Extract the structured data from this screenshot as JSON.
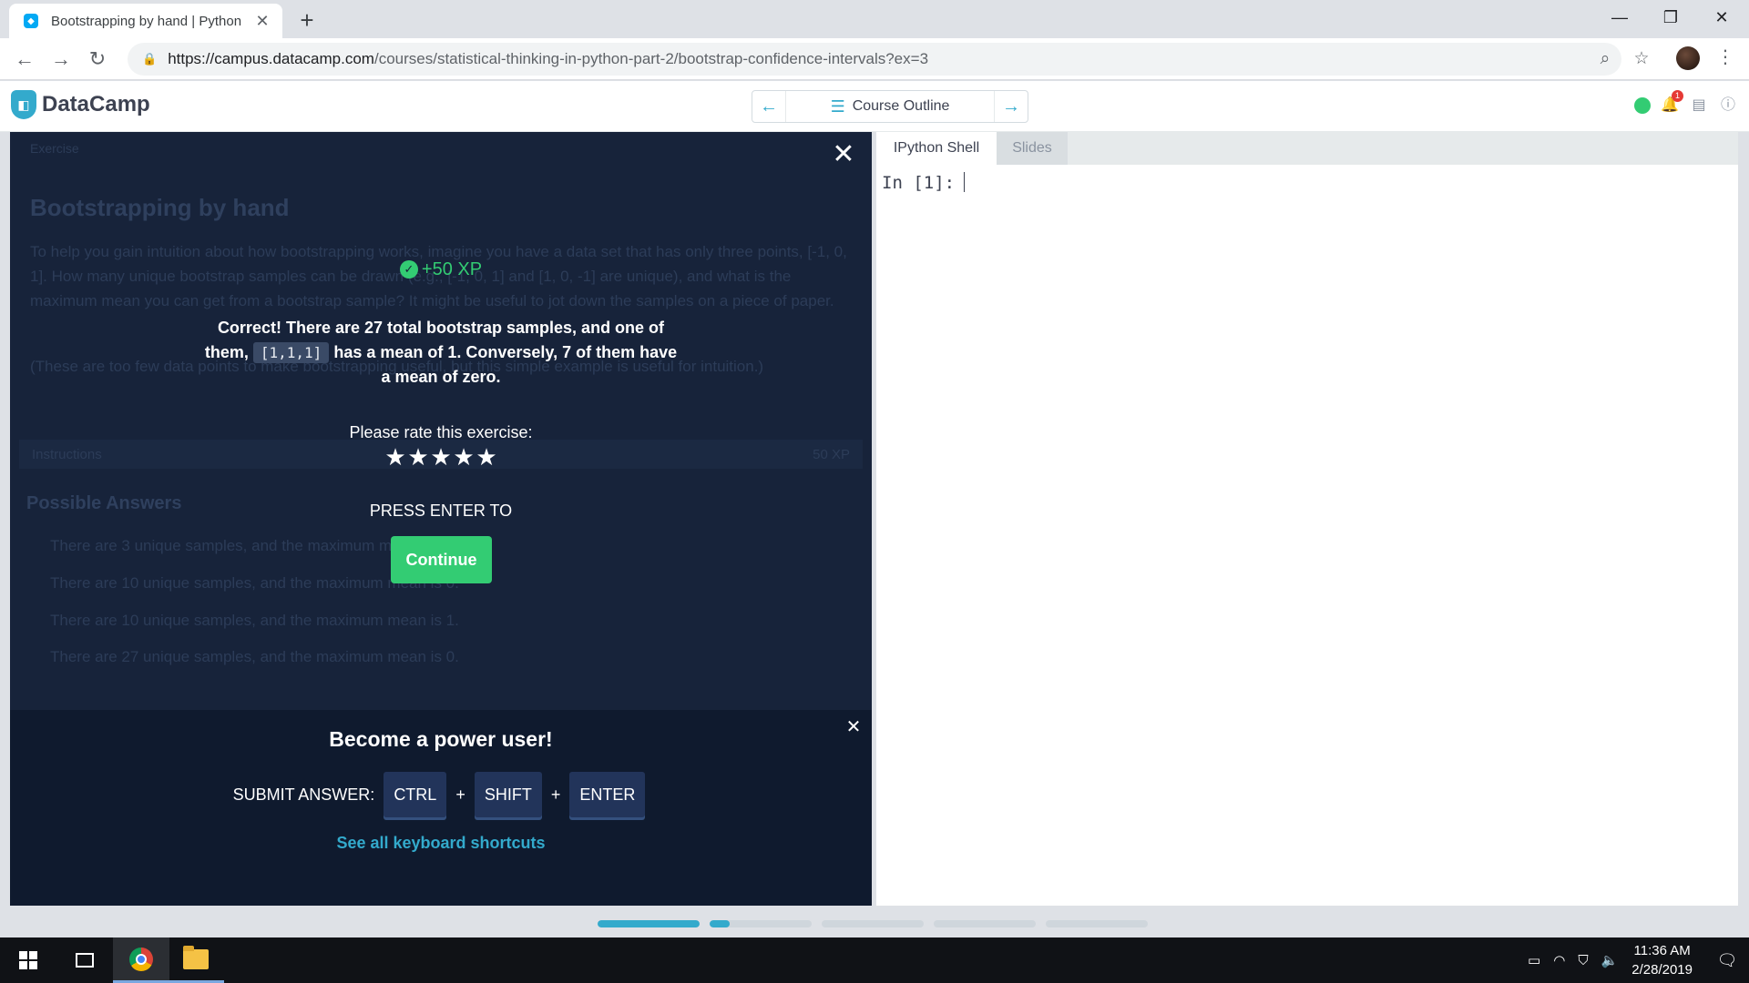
{
  "browser": {
    "tab_title": "Bootstrapping by hand | Python",
    "url_host": "https://campus.datacamp.com",
    "url_path": "/courses/statistical-thinking-in-python-part-2/bootstrap-confidence-intervals?ex=3"
  },
  "header": {
    "brand": "DataCamp",
    "course_outline": "Course Outline",
    "notification_count": "1"
  },
  "exercise": {
    "label": "Exercise",
    "title": "Bootstrapping by hand",
    "body": "To help you gain intuition about how bootstrapping works, imagine you have a data set that has only three points, [-1, 0, 1]. How many unique bootstrap samples can be drawn (e.g., [-1, 0, 1] and [1, 0, -1] are unique), and what is the maximum mean you can get from a bootstrap sample? It might be useful to jot down the samples on a piece of paper.",
    "note": "(These are too few data points to make bootstrapping useful, but this simple example is useful for intuition.)",
    "instructions_label": "Instructions",
    "instructions_xp": "50 XP",
    "possible_answers_title": "Possible Answers",
    "answers": [
      "There are 3 unique samples, and the maximum mean is 1.",
      "There are 10 unique samples, and the maximum mean is 0.",
      "There are 10 unique samples, and the maximum mean is 1.",
      "There are 27 unique samples, and the maximum mean is 0."
    ]
  },
  "modal": {
    "xp": "+50 XP",
    "feedback_before": "Correct! There are 27 total bootstrap samples, and one of them,",
    "feedback_code": "[1,1,1]",
    "feedback_after": "has a mean of 1. Conversely, 7 of them have a mean of zero.",
    "rate_label": "Please rate this exercise:",
    "star_count": 5,
    "press_enter": "PRESS ENTER TO",
    "continue_label": "Continue"
  },
  "power_user": {
    "title": "Become a power user!",
    "submit_label": "SUBMIT ANSWER:",
    "keys": [
      "CTRL",
      "SHIFT",
      "ENTER"
    ],
    "see_all": "See all keyboard shortcuts"
  },
  "console": {
    "tabs": [
      "IPython Shell",
      "Slides"
    ],
    "prompt": "In [1]:"
  },
  "progress": {
    "segments": [
      1.0,
      0.2,
      0,
      0,
      0
    ]
  },
  "taskbar": {
    "time": "11:36 AM",
    "date": "2/28/2019"
  },
  "colors": {
    "accent_blue": "#33aacc",
    "success_green": "#33cc73",
    "panel_navy": "#17233a"
  }
}
